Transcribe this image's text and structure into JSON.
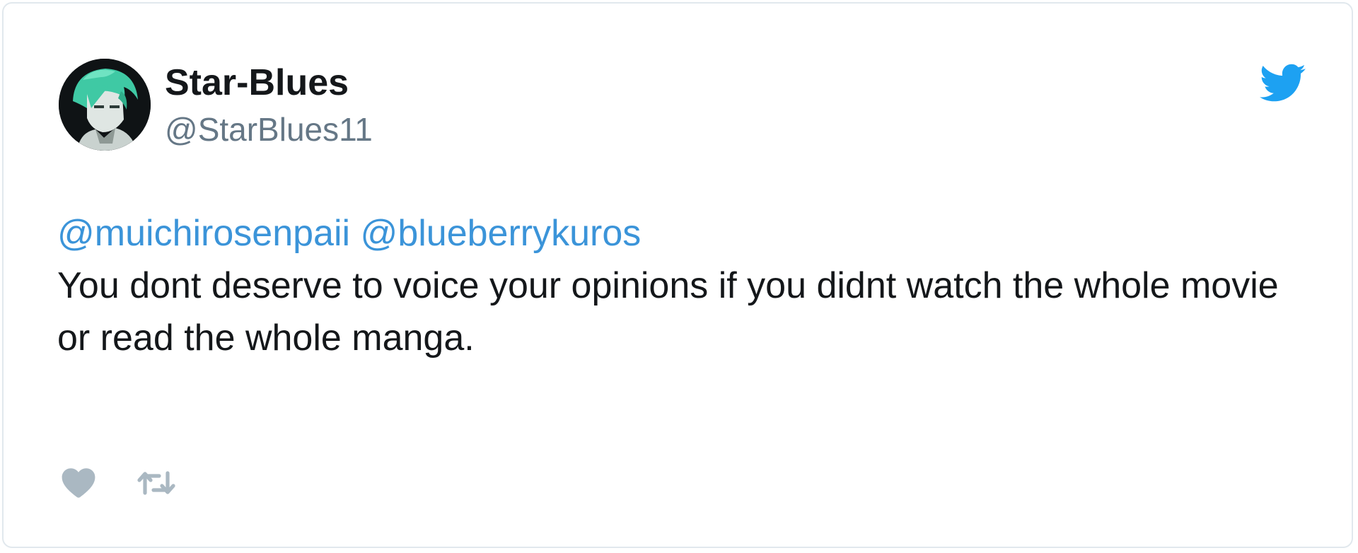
{
  "tweet": {
    "author": {
      "display_name": "Star-Blues",
      "handle": "@StarBlues11",
      "avatar_icon": "avatar-green-hair-character"
    },
    "mentions": [
      "@muichirosenpaii",
      "@blueberrykuros"
    ],
    "text": "You dont deserve to voice your opinions if you didnt watch the whole movie or read the whole manga.",
    "brand_icon": "twitter-bird-icon",
    "actions": [
      {
        "icon": "heart-icon"
      },
      {
        "icon": "retweet-icon"
      }
    ]
  },
  "colors": {
    "name": "#14171a",
    "handle": "#657786",
    "mention": "#3b94d9",
    "twitter_blue": "#1da1f2",
    "action_gray": "#aab8c2",
    "border": "#e1e8ed"
  }
}
